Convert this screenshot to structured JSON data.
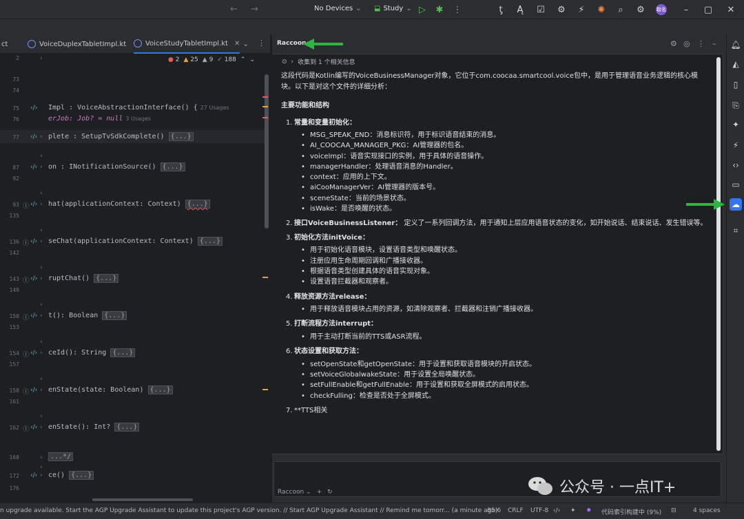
{
  "titlebar": {
    "device": "No Devices",
    "config": "Study"
  },
  "editor": {
    "tabs": [
      {
        "label": "ct"
      },
      {
        "label": "VoiceDuplexTabletImpl.kt"
      },
      {
        "label": "VoiceStudyTabletImpl.kt"
      }
    ],
    "inspections": {
      "errors": "2",
      "warnings": "25",
      "weak": "9",
      "ok": "188"
    },
    "lines": [
      {
        "num": "2",
        "code": ""
      },
      {
        "num": "73",
        "code": ""
      },
      {
        "num": "74",
        "code": ""
      },
      {
        "num": "75",
        "code": "Impl : VoiceAbstractionInterface() {",
        "hint": "27 Usages"
      },
      {
        "num": "76",
        "code": "erJob: Job? = null",
        "hint": "3 Usages"
      },
      {
        "num": "77",
        "code": "plete : SetupTvSdkComplete()",
        "fold": "{...}"
      },
      {
        "num": "87",
        "code": "on : INotificationSource()",
        "fold": "{...}"
      },
      {
        "num": "92",
        "code": ""
      },
      {
        "num": "93",
        "code": "hat(applicationContext: Context)",
        "fold": "{...}"
      },
      {
        "num": "135",
        "code": ""
      },
      {
        "num": "136",
        "code": "seChat(applicationContext: Context)",
        "fold": "{...}"
      },
      {
        "num": "142",
        "code": ""
      },
      {
        "num": "143",
        "code": "ruptChat()",
        "fold": "{...}"
      },
      {
        "num": "149",
        "code": ""
      },
      {
        "num": "150",
        "code": "t(): Boolean",
        "fold": "{...}"
      },
      {
        "num": "153",
        "code": ""
      },
      {
        "num": "154",
        "code": "ceId(): String",
        "fold": "{...}"
      },
      {
        "num": "157",
        "code": ""
      },
      {
        "num": "158",
        "code": "enState(state: Boolean)",
        "fold": "{...}"
      },
      {
        "num": "161",
        "code": ""
      },
      {
        "num": "162",
        "code": "enState(): Int?",
        "fold": "{...}"
      },
      {
        "num": "168",
        "code": "...*/"
      },
      {
        "num": "172",
        "code": "ce()",
        "fold": "{...}"
      },
      {
        "num": "176",
        "code": ""
      }
    ]
  },
  "raccoon": {
    "title": "Raccoon",
    "refs": "收集到 1 个相关信息",
    "intro": "这段代码是Kotlin编写的VoiceBusinessManager对象，它位于com.coocaa.smartcool.voice包中，是用于管理语音业务逻辑的核心模块。以下是对这个文件的详细分析：",
    "heading": "主要功能和结构",
    "sections": [
      {
        "num": "1.",
        "title": "常量和变量初始化：",
        "items": [
          "MSG_SPEAK_END：消息标识符，用于标识语音结束的消息。",
          "AI_COOCAA_MANAGER_PKG：AI管理器的包名。",
          "voiceImpl：语音实现接口的实例，用于具体的语音操作。",
          "managerHandler：处理语音消息的Handler。",
          "context：应用的上下文。",
          "aiCooManagerVer：AI管理器的版本号。",
          "sceneState：当前的场景状态。",
          "isWake：是否唤醒的状态。"
        ]
      },
      {
        "num": "2.",
        "title": "接口VoiceBusinessListener：",
        "tail": " 定义了一系列回调方法，用于通知上层应用语音状态的变化，如开始说话、结束说话、发生错误等。",
        "items": []
      },
      {
        "num": "3.",
        "title": "初始化方法initVoice：",
        "items": [
          "用于初始化语音模块，设置语音类型和唤醒状态。",
          "注册应用生命周期回调和广播接收器。",
          "根据语音类型创建具体的语音实现对象。",
          "设置语音拦截器和观察者。"
        ]
      },
      {
        "num": "4.",
        "title": "释放资源方法release：",
        "items": [
          "用于释放语音模块占用的资源，如清除观察者、拦截器和注销广播接收器。"
        ]
      },
      {
        "num": "5.",
        "title": "打断流程方法interrupt：",
        "items": [
          "用于主动打断当前的TTS或ASR流程。"
        ]
      },
      {
        "num": "6.",
        "title": "状态设置和获取方法：",
        "items": [
          "setOpenState和getOpenState：用于设置和获取语音模块的开启状态。",
          "setVoiceGlobalwakeState：用于设置全局唤醒状态。",
          "setFullEnable和getFullEnable：用于设置和获取全屏模式的启用状态。",
          "checkFulling：检查是否处于全屏模式。"
        ]
      },
      {
        "num": "7.",
        "title": "**TTS相关",
        "plain": true,
        "items": []
      }
    ],
    "footer_label": "Raccoon"
  },
  "statusbar": {
    "message": "n upgrade available. Start the AGP Upgrade Assistant to update this project's AGP version. // Start AGP Upgrade Assistant // Remind me tomorr... (a minute ago)",
    "position": "85:6",
    "line_sep": "CRLF",
    "encoding": "UTF-8",
    "indexing": "代码索引构建中 (9%)",
    "indent": "4 spaces"
  },
  "watermark": {
    "text": "公众号 · 一点IT+"
  },
  "avatar_text": "取名",
  "colors": {
    "accent": "#3574f0",
    "arrow": "#2fb344",
    "error": "#e55b5b",
    "warning": "#e8a33d"
  }
}
